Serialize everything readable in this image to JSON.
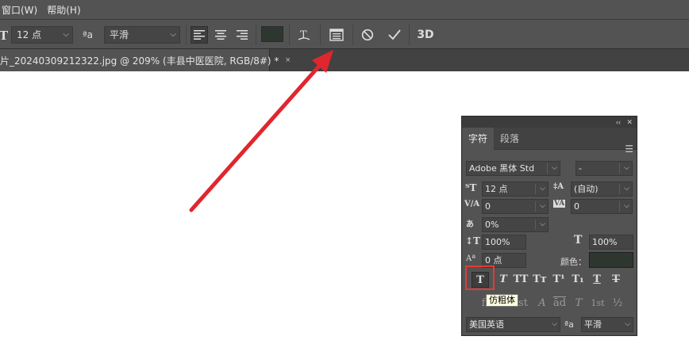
{
  "menu": {
    "items": [
      "窗口(W)",
      "帮助(H)"
    ]
  },
  "options_bar": {
    "font_size": "12 点",
    "aa_label": "ªa",
    "antialias": "平滑",
    "text_color": "#2e3630",
    "icons": [
      "text-orientation-icon",
      "align-left-icon",
      "align-center-icon",
      "align-right-icon",
      "warp-text-icon",
      "character-panel-toggle-icon",
      "cancel-icon",
      "commit-icon",
      "3d-icon"
    ],
    "label_3d": "3D"
  },
  "document_tab": {
    "title": "片_20240309212322.jpg @ 209% (丰县中医医院, RGB/8#) *",
    "close": "×"
  },
  "arrow": {
    "color": "#e0262e"
  },
  "character_panel": {
    "collapse": "‹‹",
    "close": "✕",
    "tabs": [
      "字符",
      "段落"
    ],
    "font_family": "Adobe 黑体 Std",
    "font_style": "-",
    "font_size": "12 点",
    "leading": "(自动)",
    "kerning": "0",
    "tracking": "0",
    "tsume": "0%",
    "vertical_scale": "100%",
    "horizontal_scale": "100%",
    "baseline_shift": "0 点",
    "color_label": "颜色：",
    "color": "#2e3630",
    "style_buttons": [
      "T",
      "T",
      "TT",
      "Tт",
      "T¹",
      "T₁",
      "T",
      "T"
    ],
    "opentype_buttons": [
      "ﬁ",
      "ℴ",
      "st",
      "A",
      "ād",
      "T",
      "1st",
      "½"
    ],
    "language": "美国英语",
    "aa_label": "ªa",
    "antialias": "平滑"
  },
  "tooltip": {
    "text": "仿粗体"
  },
  "highlight_color": "#e53935"
}
